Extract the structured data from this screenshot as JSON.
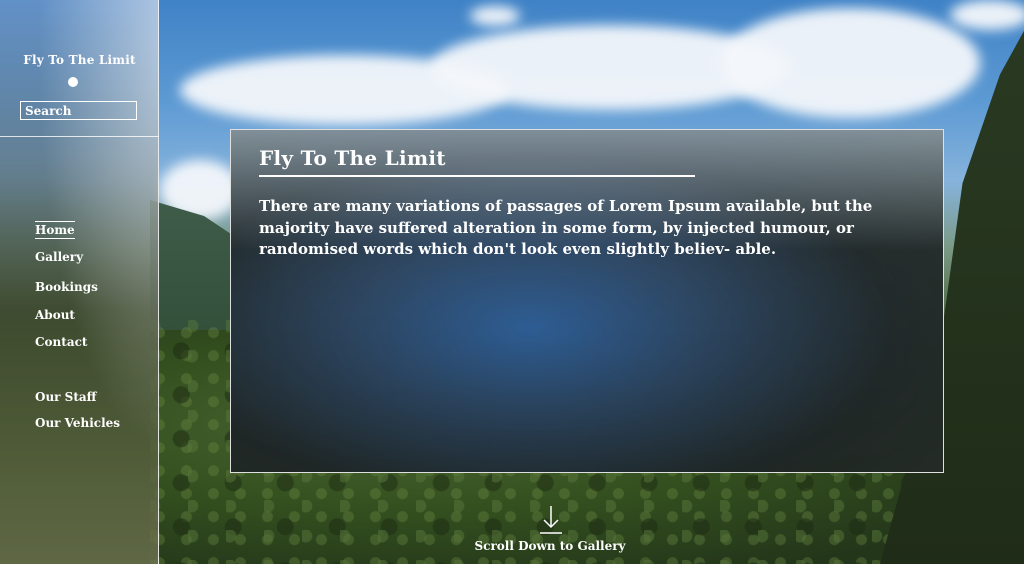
{
  "site": {
    "brand_title": "Fly To The Limit"
  },
  "search": {
    "placeholder": "Search"
  },
  "nav": {
    "primary": [
      {
        "label": "Home",
        "active": true
      },
      {
        "label": "Gallery",
        "active": false
      },
      {
        "label": "Bookings",
        "active": false
      },
      {
        "label": "About",
        "active": false
      },
      {
        "label": "Contact",
        "active": false
      }
    ],
    "secondary": [
      {
        "label": "Our Staff"
      },
      {
        "label": "Our Vehicles"
      }
    ]
  },
  "main": {
    "title": "Fly To The Limit",
    "body": "There are many variations of passages of Lorem Ipsum available, but the majority have suffered alteration in some form, by injected humour, or randomised words which don't look even slightly believ- able."
  },
  "scroll_hint": {
    "label": "Scroll Down to Gallery",
    "icon": "arrow-down-to-line-icon"
  },
  "colors": {
    "text": "#ffffff",
    "border": "#ffffff"
  }
}
